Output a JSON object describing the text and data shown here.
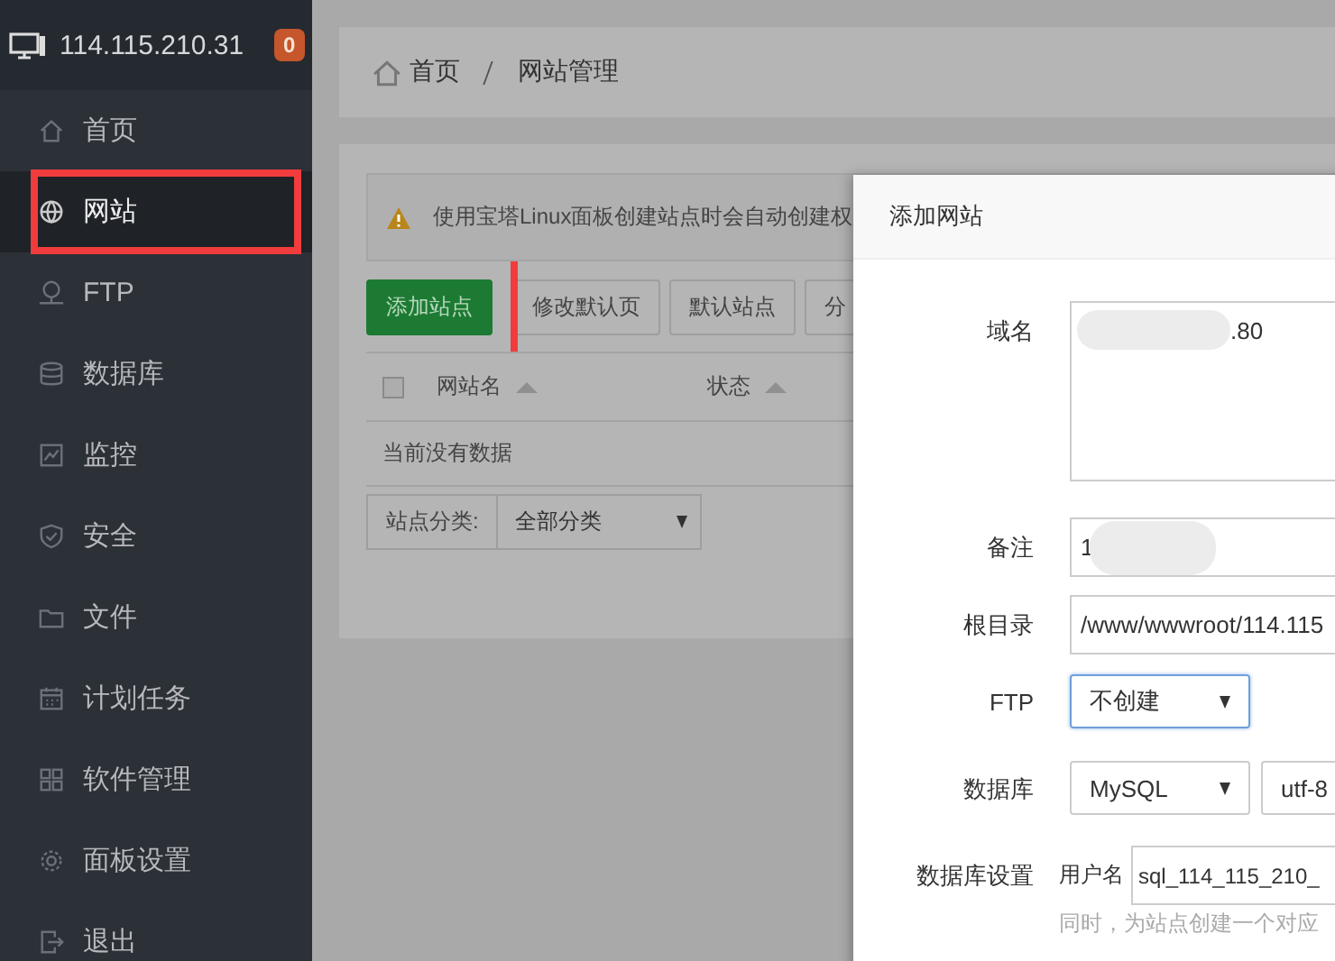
{
  "sidebar": {
    "host": "114.115.210.31",
    "badge": "0",
    "items": [
      {
        "label": "首页",
        "selected": false,
        "highlighted": false
      },
      {
        "label": "网站",
        "selected": true,
        "highlighted": true
      },
      {
        "label": "FTP",
        "selected": false,
        "highlighted": false
      },
      {
        "label": "数据库",
        "selected": false,
        "highlighted": false
      },
      {
        "label": "监控",
        "selected": false,
        "highlighted": false
      },
      {
        "label": "安全",
        "selected": false,
        "highlighted": false
      },
      {
        "label": "文件",
        "selected": false,
        "highlighted": false
      },
      {
        "label": "计划任务",
        "selected": false,
        "highlighted": false
      },
      {
        "label": "软件管理",
        "selected": false,
        "highlighted": false
      },
      {
        "label": "面板设置",
        "selected": false,
        "highlighted": false
      },
      {
        "label": "退出",
        "selected": false,
        "highlighted": false
      }
    ]
  },
  "breadcrumb": [
    "首页",
    "网站管理"
  ],
  "notice": "使用宝塔Linux面板创建站点时会自动创建权",
  "toolbar": [
    {
      "label": "添加站点",
      "kind": "primary",
      "highlighted": true
    },
    {
      "label": "修改默认页",
      "kind": "default",
      "highlighted": false
    },
    {
      "label": "默认站点",
      "kind": "default",
      "highlighted": false
    },
    {
      "label": "分",
      "kind": "default",
      "highlighted": false
    }
  ],
  "table": {
    "select_all": false,
    "columns": [
      {
        "label": "网站名",
        "sortable": true
      },
      {
        "label": "状态",
        "sortable": true
      }
    ],
    "empty_text": "当前没有数据"
  },
  "filter": {
    "label": "站点分类:",
    "value": "全部分类"
  },
  "dialog": {
    "title": "添加网站",
    "fields": [
      {
        "label": "域名",
        "kind": "textarea",
        "value": ".80",
        "redacted": true
      },
      {
        "label": "备注",
        "kind": "text",
        "value": "1",
        "redacted": true
      },
      {
        "label": "根目录",
        "kind": "text",
        "value": "/www/wwwroot/114.115",
        "redacted": false
      },
      {
        "label": "FTP",
        "kind": "selects",
        "selects": [
          {
            "value": "不创建",
            "focused": true,
            "caret": true
          }
        ]
      },
      {
        "label": "数据库",
        "kind": "selects",
        "selects": [
          {
            "value": "MySQL",
            "focused": false,
            "caret": true
          },
          {
            "value": "utf-8",
            "focused": false,
            "caret": false
          }
        ]
      },
      {
        "label": "数据库设置",
        "kind": "prefixed",
        "prefix": "用户名",
        "value": "sql_114_115_210_",
        "hint": "同时，为站点创建一个对应"
      }
    ]
  }
}
